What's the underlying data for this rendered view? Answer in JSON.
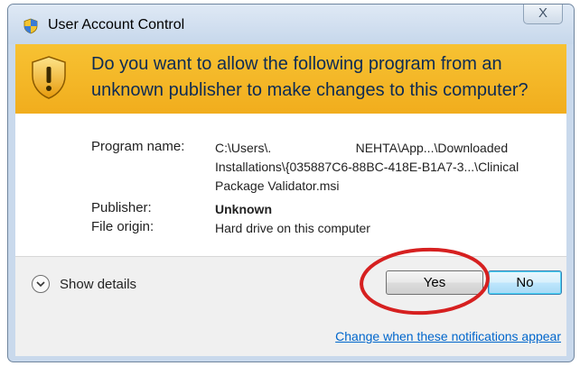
{
  "window": {
    "title": "User Account Control",
    "close_glyph": "⊗",
    "close_label": "X"
  },
  "banner": {
    "question": "Do you want to allow the following program from an unknown publisher to make changes to this computer?"
  },
  "details": {
    "program_label": "Program name:",
    "program_line1": "C:\\Users\\.                        NEHTA\\App...\\Downloaded",
    "program_line2": "Installations\\{035887C6-88BC-418E-B1A7-3...\\Clinical",
    "program_line3": "Package Validator.msi",
    "publisher_label": "Publisher:",
    "publisher_value": "Unknown",
    "origin_label": "File origin:",
    "origin_value": "Hard drive on this computer"
  },
  "actions": {
    "show_details_label": "Show details",
    "yes_label": "Yes",
    "no_label": "No"
  },
  "footer": {
    "change_link": "Change when these notifications appear"
  },
  "colors": {
    "banner": "#f3b526",
    "banner_text": "#0d2b54",
    "link": "#0066cc",
    "annotation_circle": "#d62020"
  },
  "icons": {
    "title": "uac-shield-icon",
    "banner": "warning-shield-icon",
    "details": "chevron-down-icon",
    "close": "close-icon"
  }
}
